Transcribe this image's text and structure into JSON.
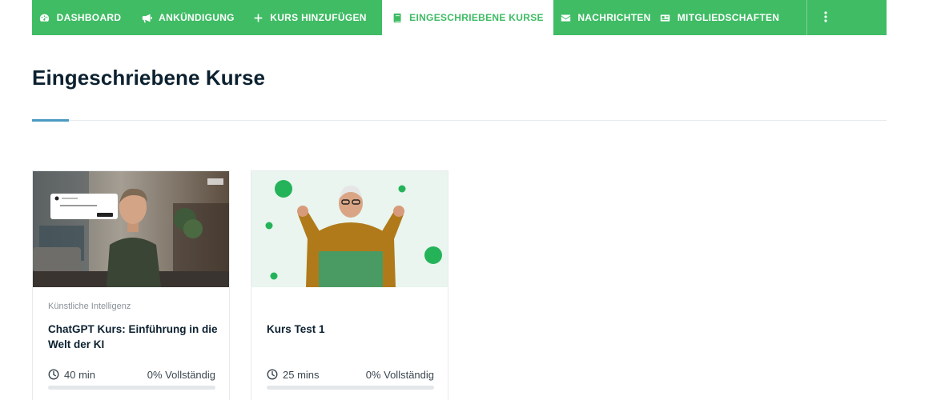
{
  "nav": {
    "items": [
      {
        "label": "DASHBOARD",
        "icon": "dashboard-gauge-icon"
      },
      {
        "label": "ANKÜNDIGUNG",
        "icon": "megaphone-icon"
      },
      {
        "label": "KURS HINZUFÜGEN",
        "icon": "plus-icon"
      },
      {
        "label": "EINGESCHRIEBENE KURSE",
        "icon": "book-icon",
        "active": true
      },
      {
        "label": "NACHRICHTEN",
        "icon": "envelope-icon"
      },
      {
        "label": "MITGLIEDSCHAFTEN",
        "icon": "id-card-icon"
      }
    ],
    "more_icon": "vertical-ellipsis-icon",
    "colors": {
      "background": "#3fbc64",
      "active_text": "#3fbc64"
    }
  },
  "page": {
    "title": "Eingeschriebene Kurse",
    "accent_color": "#4a9ac2"
  },
  "courses": [
    {
      "category": "Künstliche Intelligenz",
      "title": "ChatGPT Kurs: Einführung in die Welt der KI",
      "duration": "40 min",
      "progress_label": "0% Vollständig",
      "progress": 0
    },
    {
      "category": "",
      "title": "Kurs Test 1",
      "duration": "25 mins",
      "progress_label": "0% Vollständig",
      "progress": 0
    }
  ]
}
